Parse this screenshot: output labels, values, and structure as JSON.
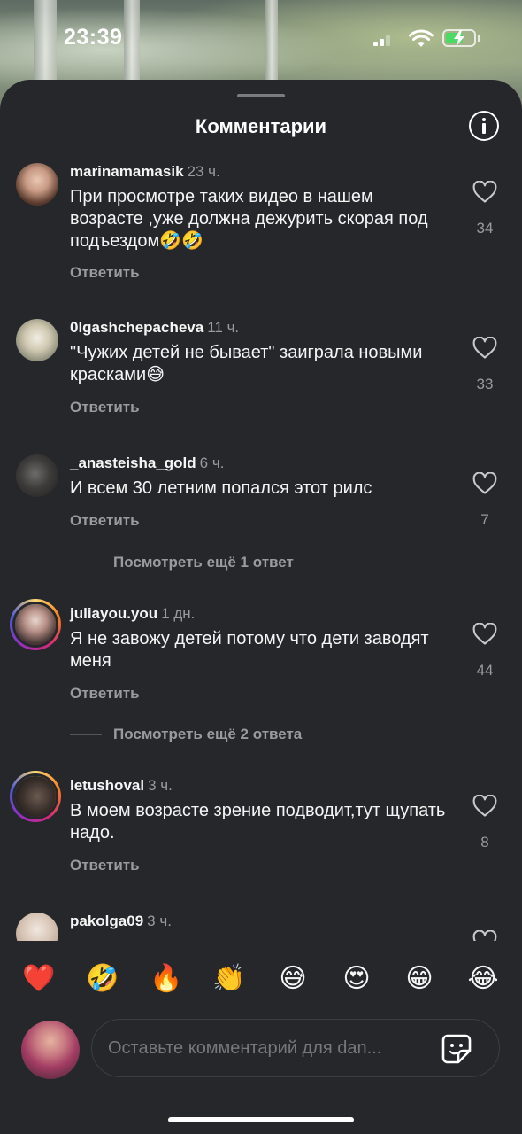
{
  "status_bar": {
    "time": "23:39"
  },
  "sheet": {
    "title": "Комментарии"
  },
  "comments": [
    {
      "username": "marinamamasik",
      "age": "23 ч.",
      "text": "При просмотре таких видео в нашем возрасте ,уже должна дежурить скорая под подъездом🤣🤣",
      "reply_label": "Ответить",
      "likes": "34"
    },
    {
      "username": "0lgashchepacheva",
      "age": "11 ч.",
      "text": "\"Чужих детей не бывает\" заиграла новыми красками😅",
      "reply_label": "Ответить",
      "likes": "33"
    },
    {
      "username": "_anasteisha_gold",
      "age": "6 ч.",
      "text": "И всем 30 летним попался этот рилс",
      "reply_label": "Ответить",
      "likes": "7",
      "more_replies": "Посмотреть ещё 1 ответ"
    },
    {
      "username": "juliayou.you",
      "age": "1 дн.",
      "text": "Я не завожу детей потому что дети заводят меня",
      "reply_label": "Ответить",
      "likes": "44",
      "more_replies": "Посмотреть ещё 2 ответа"
    },
    {
      "username": "letushoval",
      "age": "3 ч.",
      "text": "В моем возрасте зрение подводит,тут щупать надо.",
      "reply_label": "Ответить",
      "likes": "8"
    },
    {
      "username": "pakolga09",
      "age": "3 ч."
    }
  ],
  "emoji_bar": [
    "❤️",
    "🤣",
    "🔥",
    "👏",
    "😅",
    "😍",
    "😁",
    "😂"
  ],
  "composer": {
    "placeholder": "Оставьте комментарий для dan..."
  },
  "icons": {
    "like": "heart-outline-icon",
    "info": "info-icon",
    "sticker": "sticker-icon"
  },
  "colors": {
    "sheet_bg": "#26272b",
    "muted_text": "#9a9ba0",
    "battery_green": "#4cd964"
  }
}
